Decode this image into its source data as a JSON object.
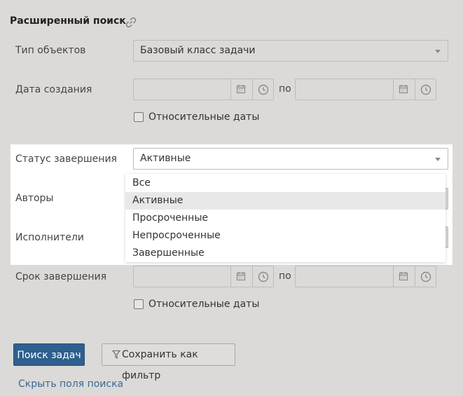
{
  "header": {
    "title": "Расширенный поиск",
    "link_icon": "link-icon"
  },
  "fields": {
    "object_type": {
      "label": "Тип объектов",
      "value": "Базовый класс задачи"
    },
    "created_date": {
      "label": "Дата создания",
      "to_label": "по",
      "relative_label": "Относительные даты"
    },
    "completion_status": {
      "label": "Статус завершения",
      "value": "Активные",
      "options": [
        "Все",
        "Активные",
        "Просроченные",
        "Непросроченные",
        "Завершенные"
      ],
      "selected_index": 1
    },
    "authors": {
      "label": "Авторы"
    },
    "executors": {
      "label": "Исполнители"
    },
    "due_date": {
      "label": "Срок завершения",
      "to_label": "по",
      "relative_label": "Относительные даты"
    }
  },
  "actions": {
    "search_label": "Поиск задач",
    "save_filter_label": "Сохранить как фильтр",
    "hide_fields_label": "Скрыть поля поиска"
  },
  "icons": {
    "calendar": "calendar-icon",
    "clock": "clock-icon",
    "filter": "filter-icon",
    "caret": "chevron-down-icon"
  },
  "colors": {
    "background": "#dbdad8",
    "primary": "#2e5f8e",
    "link": "#3a6794",
    "highlight": "#ffffff"
  }
}
